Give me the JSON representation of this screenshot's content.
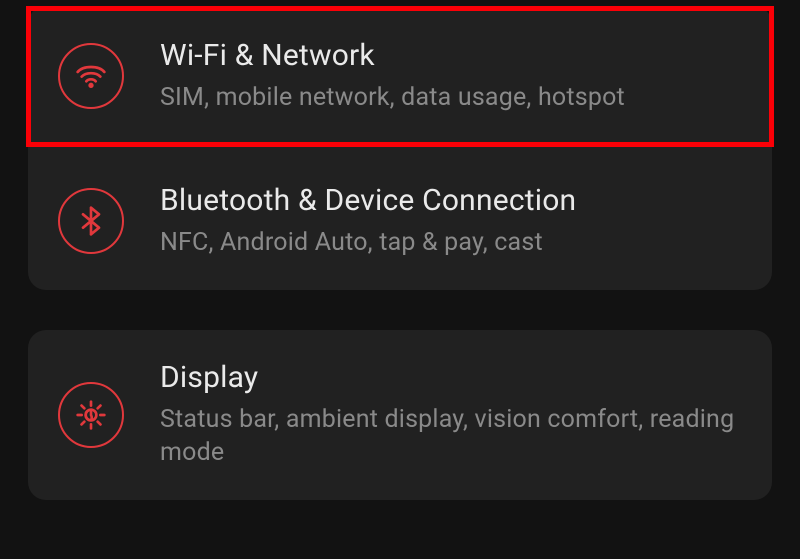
{
  "settings": {
    "items": [
      {
        "icon": "wifi-icon",
        "title": "Wi-Fi & Network",
        "subtitle": "SIM, mobile network, data usage, hotspot"
      },
      {
        "icon": "bluetooth-icon",
        "title": "Bluetooth & Device Connection",
        "subtitle": "NFC, Android Auto, tap & pay, cast"
      },
      {
        "icon": "display-icon",
        "title": "Display",
        "subtitle": "Status bar, ambient display, vision comfort, reading mode"
      }
    ]
  },
  "colors": {
    "accent": "#e1383c",
    "highlight_border": "#fb0007",
    "background": "#121212",
    "card": "#212121"
  }
}
